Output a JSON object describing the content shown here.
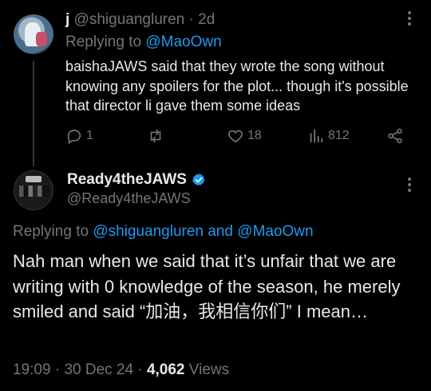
{
  "reply": {
    "name": "j",
    "handle": "@shiguangluren",
    "separator": "·",
    "time": "2d",
    "replying_prefix": "Replying to",
    "replying_to": "@MaoOwn",
    "text": "baishaJAWS said that they wrote the song without knowing any spoilers for the plot... though it's possible that director li gave them some ideas",
    "actions": {
      "replies": "1",
      "reposts": "",
      "likes": "18",
      "views": "812"
    }
  },
  "tweet": {
    "name": "Ready4theJAWS",
    "handle": "@Ready4theJAWS",
    "replying_prefix": "Replying to",
    "replying_to_1": "@shiguangluren",
    "replying_and": "and",
    "replying_to_2": "@MaoOwn",
    "text": "Nah man when we said that it’s unfair that we are writing with 0 knowledge of the season, he merely smiled and said “加油，我相信你们” I mean…",
    "time": "19:09",
    "date": "30 Dec 24",
    "separator": "·",
    "views_count": "4,062",
    "views_label": "Views"
  },
  "colors": {
    "background": "#000000",
    "text": "#e7e9ea",
    "muted": "#71767b",
    "link": "#1d9bf0",
    "verified": "#1d9bf0"
  },
  "icons": [
    "reply-icon",
    "repost-icon",
    "like-icon",
    "views-icon",
    "share-icon",
    "more-icon",
    "verified-badge-icon"
  ]
}
